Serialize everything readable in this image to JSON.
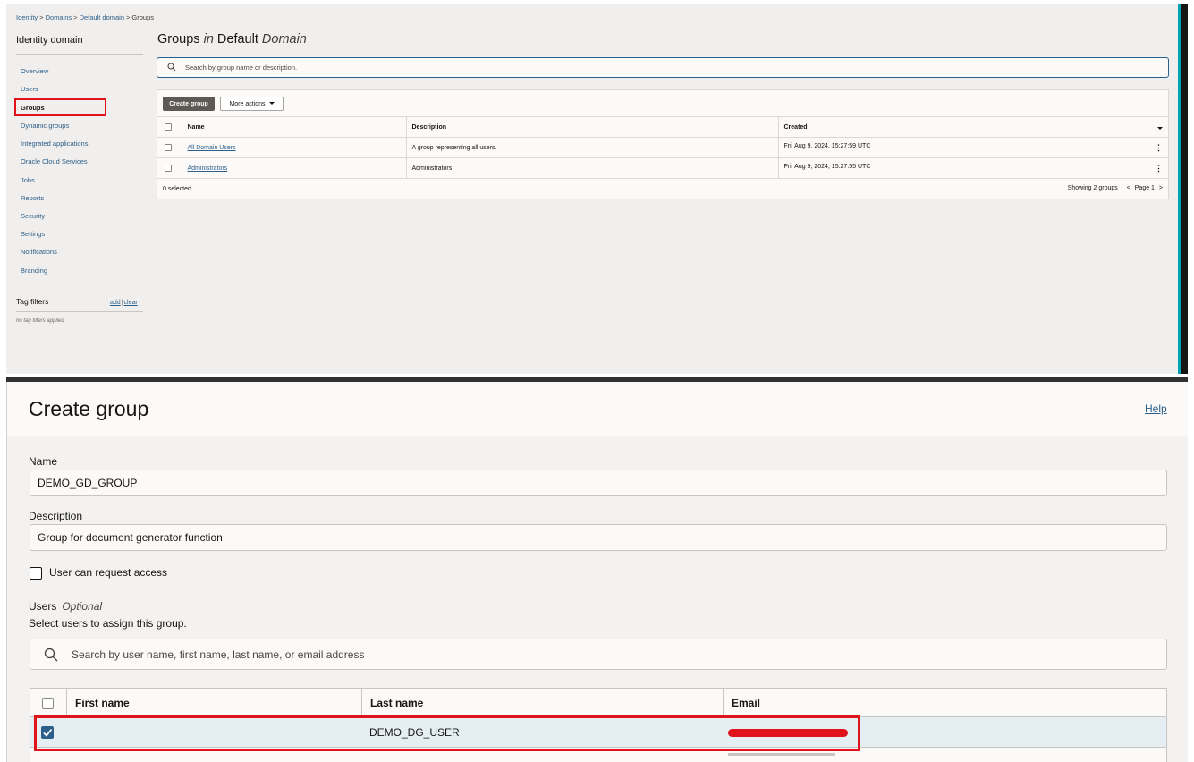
{
  "breadcrumb": [
    "Identity",
    "Domains",
    "Default domain",
    "Groups"
  ],
  "breadcrumb_sep": ">",
  "sidebar": {
    "title": "Identity domain",
    "items": [
      {
        "label": "Overview"
      },
      {
        "label": "Users"
      },
      {
        "label": "Groups",
        "active": true
      },
      {
        "label": "Dynamic groups"
      },
      {
        "label": "Integrated applications"
      },
      {
        "label": "Oracle Cloud Services"
      },
      {
        "label": "Jobs"
      },
      {
        "label": "Reports"
      },
      {
        "label": "Security"
      },
      {
        "label": "Settings"
      },
      {
        "label": "Notifications"
      },
      {
        "label": "Branding"
      }
    ],
    "tag_filters": {
      "title": "Tag filters",
      "add": "add",
      "sep": "|",
      "clear": "clear",
      "empty": "no tag filters applied"
    }
  },
  "groups_page": {
    "title_main": "Groups",
    "title_in": "in",
    "title_domain": "Default",
    "title_domain_suffix": "Domain",
    "search_placeholder": "Search by group name or description.",
    "create_button": "Create group",
    "more_actions": "More actions",
    "columns": {
      "name": "Name",
      "description": "Description",
      "created": "Created"
    },
    "rows": [
      {
        "name": "All Domain Users",
        "description": "A group representing all users.",
        "created": "Fri, Aug 9, 2024, 15:27:59 UTC"
      },
      {
        "name": "Administrators",
        "description": "Administrators",
        "created": "Fri, Aug 9, 2024, 15:27:55 UTC"
      }
    ],
    "selected": "0 selected",
    "showing": "Showing 2 groups",
    "page": "Page 1"
  },
  "create_group": {
    "title": "Create group",
    "help": "Help",
    "name_label": "Name",
    "name_value": "DEMO_GD_GROUP",
    "description_label": "Description",
    "description_value": "Group for document generator function",
    "request_access_label": "User can request access",
    "users_label": "Users",
    "users_optional": "Optional",
    "users_help": "Select users to assign this group.",
    "users_search_placeholder": "Search by user name, first name, last name, or email address",
    "columns": {
      "first_name": "First name",
      "last_name": "Last name",
      "email": "Email"
    },
    "rows": [
      {
        "first_name": "",
        "last_name": "DEMO_DG_USER",
        "checked": true
      }
    ]
  },
  "colors": {
    "accent": "#2c5f8a",
    "highlight": "#e0131b",
    "primary_button": "#5e5954"
  }
}
